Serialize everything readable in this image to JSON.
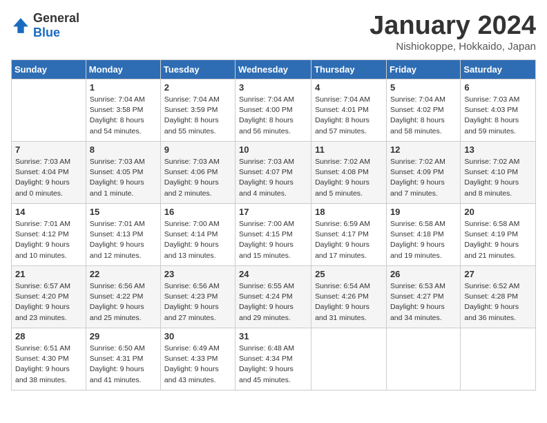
{
  "header": {
    "logo_general": "General",
    "logo_blue": "Blue",
    "month_title": "January 2024",
    "location": "Nishiokoppe, Hokkaido, Japan"
  },
  "weekdays": [
    "Sunday",
    "Monday",
    "Tuesday",
    "Wednesday",
    "Thursday",
    "Friday",
    "Saturday"
  ],
  "weeks": [
    [
      {
        "day": "",
        "sunrise": "",
        "sunset": "",
        "daylight": ""
      },
      {
        "day": "1",
        "sunrise": "Sunrise: 7:04 AM",
        "sunset": "Sunset: 3:58 PM",
        "daylight": "Daylight: 8 hours and 54 minutes."
      },
      {
        "day": "2",
        "sunrise": "Sunrise: 7:04 AM",
        "sunset": "Sunset: 3:59 PM",
        "daylight": "Daylight: 8 hours and 55 minutes."
      },
      {
        "day": "3",
        "sunrise": "Sunrise: 7:04 AM",
        "sunset": "Sunset: 4:00 PM",
        "daylight": "Daylight: 8 hours and 56 minutes."
      },
      {
        "day": "4",
        "sunrise": "Sunrise: 7:04 AM",
        "sunset": "Sunset: 4:01 PM",
        "daylight": "Daylight: 8 hours and 57 minutes."
      },
      {
        "day": "5",
        "sunrise": "Sunrise: 7:04 AM",
        "sunset": "Sunset: 4:02 PM",
        "daylight": "Daylight: 8 hours and 58 minutes."
      },
      {
        "day": "6",
        "sunrise": "Sunrise: 7:03 AM",
        "sunset": "Sunset: 4:03 PM",
        "daylight": "Daylight: 8 hours and 59 minutes."
      }
    ],
    [
      {
        "day": "7",
        "sunrise": "Sunrise: 7:03 AM",
        "sunset": "Sunset: 4:04 PM",
        "daylight": "Daylight: 9 hours and 0 minutes."
      },
      {
        "day": "8",
        "sunrise": "Sunrise: 7:03 AM",
        "sunset": "Sunset: 4:05 PM",
        "daylight": "Daylight: 9 hours and 1 minute."
      },
      {
        "day": "9",
        "sunrise": "Sunrise: 7:03 AM",
        "sunset": "Sunset: 4:06 PM",
        "daylight": "Daylight: 9 hours and 2 minutes."
      },
      {
        "day": "10",
        "sunrise": "Sunrise: 7:03 AM",
        "sunset": "Sunset: 4:07 PM",
        "daylight": "Daylight: 9 hours and 4 minutes."
      },
      {
        "day": "11",
        "sunrise": "Sunrise: 7:02 AM",
        "sunset": "Sunset: 4:08 PM",
        "daylight": "Daylight: 9 hours and 5 minutes."
      },
      {
        "day": "12",
        "sunrise": "Sunrise: 7:02 AM",
        "sunset": "Sunset: 4:09 PM",
        "daylight": "Daylight: 9 hours and 7 minutes."
      },
      {
        "day": "13",
        "sunrise": "Sunrise: 7:02 AM",
        "sunset": "Sunset: 4:10 PM",
        "daylight": "Daylight: 9 hours and 8 minutes."
      }
    ],
    [
      {
        "day": "14",
        "sunrise": "Sunrise: 7:01 AM",
        "sunset": "Sunset: 4:12 PM",
        "daylight": "Daylight: 9 hours and 10 minutes."
      },
      {
        "day": "15",
        "sunrise": "Sunrise: 7:01 AM",
        "sunset": "Sunset: 4:13 PM",
        "daylight": "Daylight: 9 hours and 12 minutes."
      },
      {
        "day": "16",
        "sunrise": "Sunrise: 7:00 AM",
        "sunset": "Sunset: 4:14 PM",
        "daylight": "Daylight: 9 hours and 13 minutes."
      },
      {
        "day": "17",
        "sunrise": "Sunrise: 7:00 AM",
        "sunset": "Sunset: 4:15 PM",
        "daylight": "Daylight: 9 hours and 15 minutes."
      },
      {
        "day": "18",
        "sunrise": "Sunrise: 6:59 AM",
        "sunset": "Sunset: 4:17 PM",
        "daylight": "Daylight: 9 hours and 17 minutes."
      },
      {
        "day": "19",
        "sunrise": "Sunrise: 6:58 AM",
        "sunset": "Sunset: 4:18 PM",
        "daylight": "Daylight: 9 hours and 19 minutes."
      },
      {
        "day": "20",
        "sunrise": "Sunrise: 6:58 AM",
        "sunset": "Sunset: 4:19 PM",
        "daylight": "Daylight: 9 hours and 21 minutes."
      }
    ],
    [
      {
        "day": "21",
        "sunrise": "Sunrise: 6:57 AM",
        "sunset": "Sunset: 4:20 PM",
        "daylight": "Daylight: 9 hours and 23 minutes."
      },
      {
        "day": "22",
        "sunrise": "Sunrise: 6:56 AM",
        "sunset": "Sunset: 4:22 PM",
        "daylight": "Daylight: 9 hours and 25 minutes."
      },
      {
        "day": "23",
        "sunrise": "Sunrise: 6:56 AM",
        "sunset": "Sunset: 4:23 PM",
        "daylight": "Daylight: 9 hours and 27 minutes."
      },
      {
        "day": "24",
        "sunrise": "Sunrise: 6:55 AM",
        "sunset": "Sunset: 4:24 PM",
        "daylight": "Daylight: 9 hours and 29 minutes."
      },
      {
        "day": "25",
        "sunrise": "Sunrise: 6:54 AM",
        "sunset": "Sunset: 4:26 PM",
        "daylight": "Daylight: 9 hours and 31 minutes."
      },
      {
        "day": "26",
        "sunrise": "Sunrise: 6:53 AM",
        "sunset": "Sunset: 4:27 PM",
        "daylight": "Daylight: 9 hours and 34 minutes."
      },
      {
        "day": "27",
        "sunrise": "Sunrise: 6:52 AM",
        "sunset": "Sunset: 4:28 PM",
        "daylight": "Daylight: 9 hours and 36 minutes."
      }
    ],
    [
      {
        "day": "28",
        "sunrise": "Sunrise: 6:51 AM",
        "sunset": "Sunset: 4:30 PM",
        "daylight": "Daylight: 9 hours and 38 minutes."
      },
      {
        "day": "29",
        "sunrise": "Sunrise: 6:50 AM",
        "sunset": "Sunset: 4:31 PM",
        "daylight": "Daylight: 9 hours and 41 minutes."
      },
      {
        "day": "30",
        "sunrise": "Sunrise: 6:49 AM",
        "sunset": "Sunset: 4:33 PM",
        "daylight": "Daylight: 9 hours and 43 minutes."
      },
      {
        "day": "31",
        "sunrise": "Sunrise: 6:48 AM",
        "sunset": "Sunset: 4:34 PM",
        "daylight": "Daylight: 9 hours and 45 minutes."
      },
      {
        "day": "",
        "sunrise": "",
        "sunset": "",
        "daylight": ""
      },
      {
        "day": "",
        "sunrise": "",
        "sunset": "",
        "daylight": ""
      },
      {
        "day": "",
        "sunrise": "",
        "sunset": "",
        "daylight": ""
      }
    ]
  ]
}
